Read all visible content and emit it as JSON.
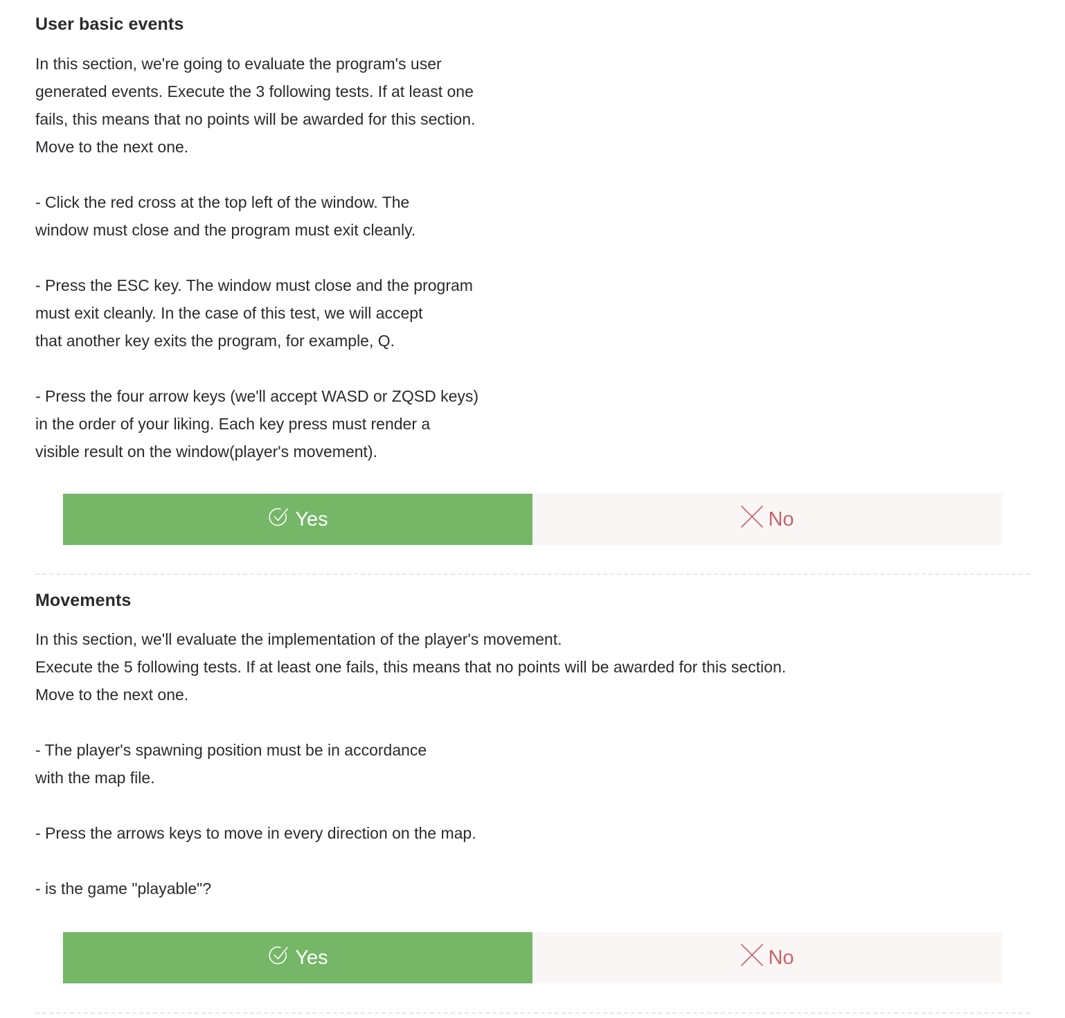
{
  "colors": {
    "text": "#2a2a2f",
    "yes_background": "#75b667",
    "yes_text": "#ffffff",
    "no_background": "#faf6f6",
    "no_text": "#c7636b",
    "divider": "#e8e8ea"
  },
  "sections": [
    {
      "title": "User basic events",
      "body": "In this section, we're going to evaluate the program's user\ngenerated events. Execute the 3 following tests. If at least one\nfails, this means that no points will be awarded for this section.\nMove to the next one.\n\n- Click the red cross at the top left of the window. The\nwindow must close and the program must exit cleanly.\n\n- Press the ESC key. The window must close and the program\nmust exit cleanly. In the case of this test, we will accept\nthat another key exits the program, for example, Q.\n\n- Press the four arrow keys (we'll accept WASD or ZQSD keys)\nin the order of your liking. Each key press must render a\nvisible result on the window(player's movement).",
      "yes_label": "Yes",
      "no_label": "No",
      "yes_icon": "check-circle-icon",
      "no_icon": "cross-icon"
    },
    {
      "title": "Movements",
      "body": "In this section, we'll evaluate the implementation of the player's movement.\nExecute the 5 following tests. If at least one fails, this means that no points will be awarded for this section.\nMove to the next one.\n\n- The player's spawning position must be in accordance\nwith the map file.\n\n- Press the arrows keys to move in every direction on the map.\n\n- is the game \"playable\"?",
      "yes_label": "Yes",
      "no_label": "No",
      "yes_icon": "check-circle-icon",
      "no_icon": "cross-icon"
    }
  ]
}
